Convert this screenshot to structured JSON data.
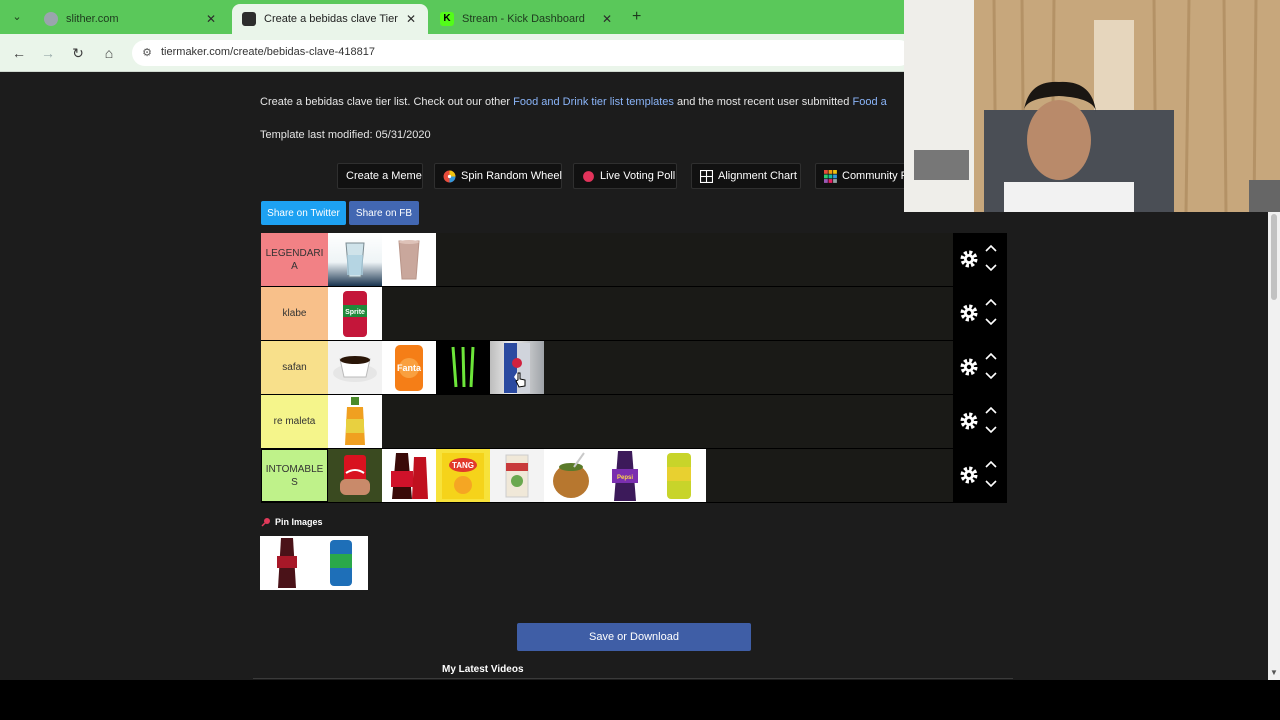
{
  "browser": {
    "tabs": [
      {
        "title": "slither.com",
        "active": false,
        "favicon_color": "#9aa5ad"
      },
      {
        "title": "Create a bebidas clave Tier List",
        "active": true,
        "favicon_color": "#2d2d2d"
      },
      {
        "title": "Stream - Kick Dashboard",
        "active": false,
        "favicon_color": "#53fc18"
      }
    ],
    "url": "tiermaker.com/create/bebidas-clave-418817",
    "nav": {
      "back": "back-arrow-icon",
      "forward": "forward-arrow-icon",
      "reload": "reload-icon",
      "home": "home-icon"
    }
  },
  "page": {
    "description_prefix": "Create a bebidas clave tier list. Check out our other ",
    "description_link1": "Food and Drink tier list templates",
    "description_middle": " and the most recent user submitted ",
    "description_link2": "Food a",
    "modified": "Template last modified: 05/31/2020",
    "actions": [
      {
        "label": "Create a Meme",
        "icon": ""
      },
      {
        "label": "Spin Random Wheel",
        "icon": "wheel-icon"
      },
      {
        "label": "Live Voting Poll",
        "icon": "red-dot-icon"
      },
      {
        "label": "Alignment Chart",
        "icon": "grid-icon"
      },
      {
        "label": "Community R",
        "icon": "colored-grid-icon"
      }
    ],
    "share_twitter": "Share on Twitter",
    "share_fb": "Share on FB",
    "tiers": [
      {
        "label": "LEGENDARIA",
        "color": "#f28185",
        "items": [
          "water-glass",
          "chocolate-milk"
        ]
      },
      {
        "label": "klabe",
        "color": "#f8c08a",
        "items": [
          "sprite-can"
        ]
      },
      {
        "label": "safan",
        "color": "#f8e08b",
        "items": [
          "coffee-cup",
          "fanta-can",
          "monster-can",
          "red-bull-can"
        ]
      },
      {
        "label": "re maleta",
        "color": "#f5f58b",
        "items": [
          "juice-bottle"
        ]
      },
      {
        "label": "INTOMABLES",
        "color": "#bff28a",
        "items": [
          "coca-cola-can",
          "cola-bottle",
          "tang-packet",
          "drink-box",
          "mate-gourd",
          "grape-soda-bottle",
          "green-can"
        ]
      }
    ],
    "pin_label": "Pin Images",
    "pool_items": [
      "soda-bottle",
      "sprite-can-blue"
    ],
    "save_button": "Save or Download",
    "latest_videos": "My Latest Videos"
  },
  "colors": {
    "tab_bar": "#5ac85a",
    "page_bg": "#1c1c1c",
    "link": "#8ab4f8",
    "twitter": "#1da1f2",
    "facebook": "#4267b2",
    "save": "#3f5ea6"
  }
}
